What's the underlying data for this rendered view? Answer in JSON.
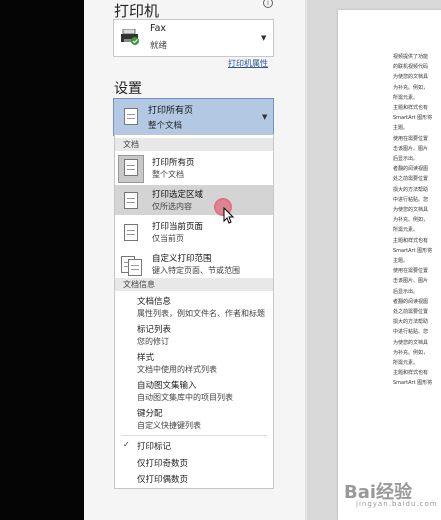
{
  "header": {
    "title": "打印机",
    "info": "i"
  },
  "printer": {
    "name": "Fax",
    "status": "就绪",
    "properties_link": "打印机属性"
  },
  "settings": {
    "title": "设置"
  },
  "range_select": {
    "label": "打印所有页",
    "sub": "整个文档"
  },
  "menu": {
    "section_document": "文档",
    "items": [
      {
        "title": "打印所有页",
        "sub": "整个文档"
      },
      {
        "title": "打印选定区域",
        "sub": "仅所选内容"
      },
      {
        "title": "打印当前页面",
        "sub": "仅当前页"
      },
      {
        "title": "自定义打印范围",
        "sub": "键入特定页面、节或范围"
      }
    ],
    "section_info": "文档信息",
    "info_items": [
      {
        "title": "文档信息",
        "sub": "属性列表，例如文件名、作者和标题"
      },
      {
        "title": "标记列表",
        "sub": "您的修订"
      },
      {
        "title": "样式",
        "sub": "文档中使用的样式列表"
      },
      {
        "title": "自动图文集输入",
        "sub": "自动图文集库中的项目列表"
      },
      {
        "title": "键分配",
        "sub": "自定义快捷键列表"
      }
    ],
    "options": [
      {
        "label": "打印标记",
        "checked": true
      },
      {
        "label": "仅打印奇数页",
        "checked": false
      },
      {
        "label": "仅打印偶数页",
        "checked": false
      }
    ]
  },
  "preview_lines": [
    "视频提供了功能",
    "的联机视频代码",
    "为使您的文档具",
    "为补充。例如，",
    "所需元素。",
    "主题和样式也有",
    "SmartArt 图形将",
    "主题。",
    "使用在需要位置",
    "击该图片。图片",
    "后显示出。",
    "者翻的阅读视图",
    "处之前需要位置",
    "损大的方法帮助",
    "中进行粘贴。您",
    "为使您的文档具",
    "为补充。例如，",
    "所需元素。",
    "主题和样式也有",
    "SmartArt 图形将",
    "主题。",
    "使用在需要位置",
    "击该图片。图片",
    "后显示出。",
    "者翻的阅读视图",
    "处之前需要位置",
    "损大的方法帮助",
    "中进行粘贴。您",
    "为使您的文档具",
    "为补充。例如，",
    "所需元素。",
    "主题和样式也有",
    "SmartArt 图形将"
  ],
  "watermark": {
    "text": "Bai经验",
    "sub": "jingyan.baidu.com"
  },
  "colors": {
    "selection": "#b3c9e3",
    "highlight": "#d4d4d4",
    "accent": "#2b579a"
  }
}
